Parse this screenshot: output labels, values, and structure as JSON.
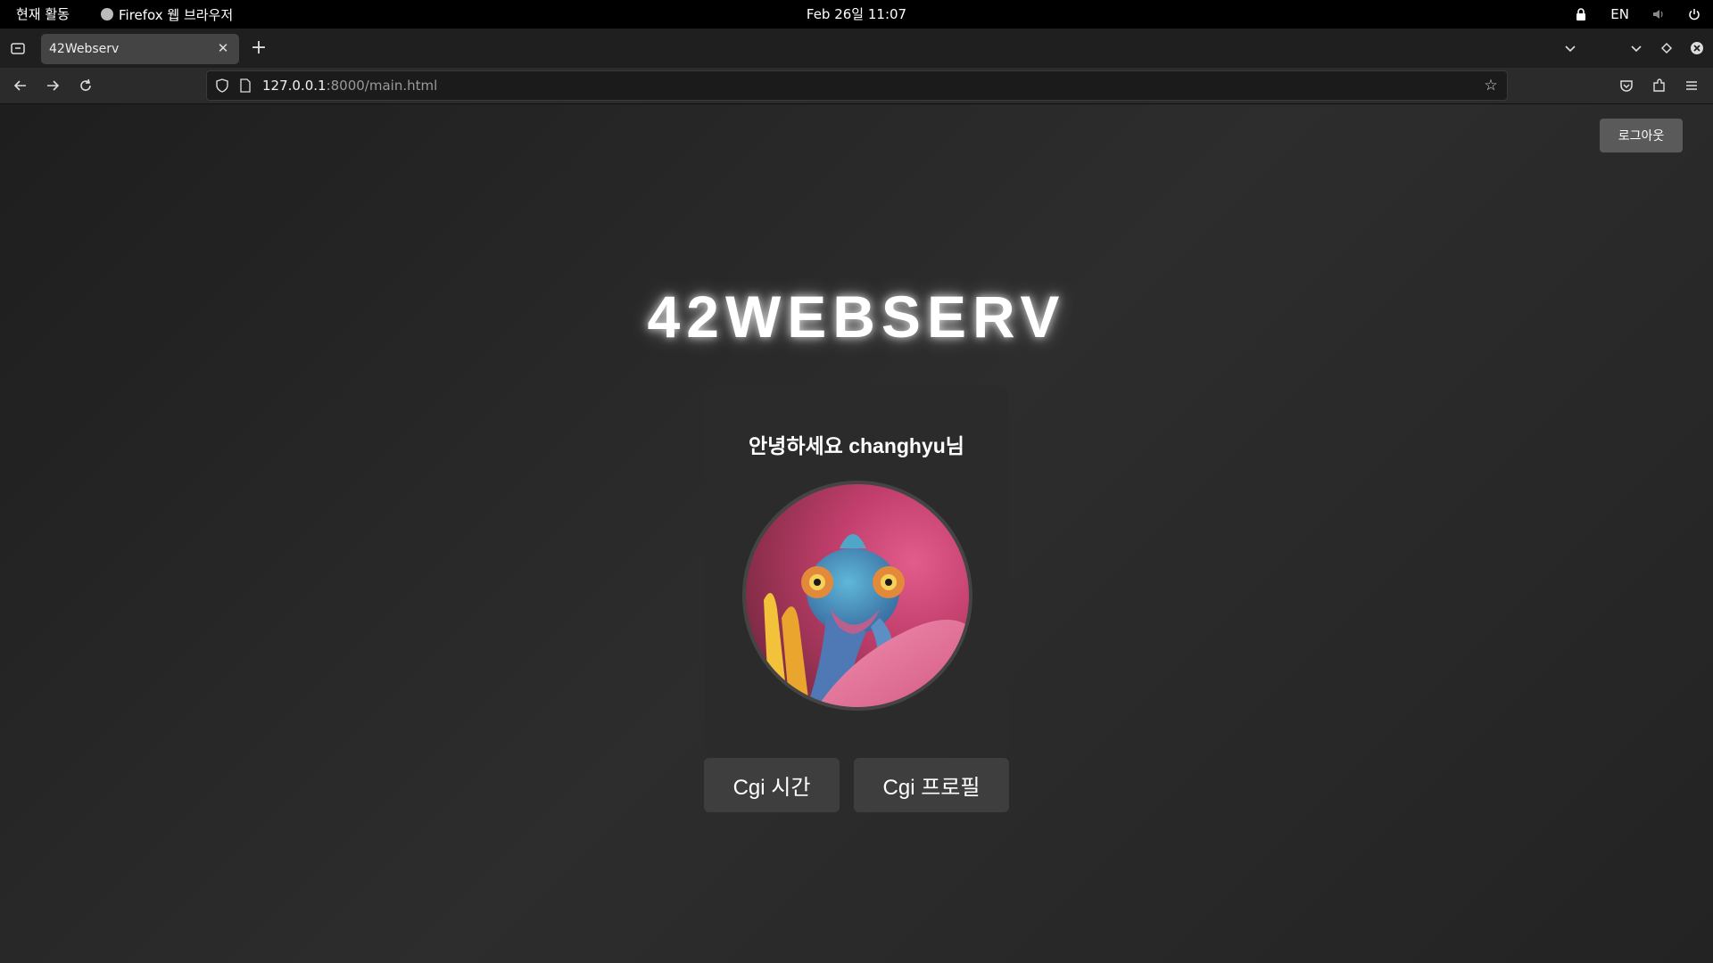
{
  "system_bar": {
    "activities": "현재 활동",
    "app_name": "Firefox 웹 브라우저",
    "clock": "Feb 26일  11:07",
    "language": "EN"
  },
  "browser": {
    "tab_title": "42Webserv",
    "url_host": "127.0.0.1",
    "url_path": ":8000/main.html"
  },
  "page": {
    "logout_label": "로그아웃",
    "site_title": "42WEBSERV",
    "greeting": "안녕하세요 changhyu님",
    "buttons": {
      "cgi_time": "Cgi 시간",
      "cgi_profile": "Cgi 프로필"
    }
  },
  "icons": {
    "lock": "lock-icon",
    "volume": "volume-icon",
    "power": "power-icon",
    "back": "back-arrow-icon",
    "forward": "forward-arrow-icon",
    "reload": "reload-icon",
    "bookmark": "star-icon",
    "pocket": "pocket-icon",
    "extensions": "puzzle-icon",
    "menu": "hamburger-menu-icon"
  }
}
